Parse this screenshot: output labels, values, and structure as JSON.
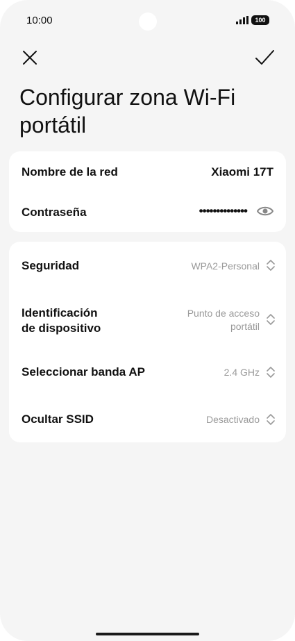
{
  "status": {
    "time": "10:00",
    "battery": "100"
  },
  "header": {
    "title": "Configurar zona Wi-Fi portátil"
  },
  "network": {
    "name_label": "Nombre de la red",
    "name_value": "Xiaomi 17T",
    "password_label": "Contraseña",
    "password_value": "••••••••••••••"
  },
  "settings": [
    {
      "label": "Seguridad",
      "value": "WPA2-Personal"
    },
    {
      "label_line1": "Identificación",
      "label_line2": "de dispositivo",
      "value_line1": "Punto de acceso",
      "value_line2": "portátil"
    },
    {
      "label": "Seleccionar banda AP",
      "value": "2.4 GHz"
    },
    {
      "label": "Ocultar SSID",
      "value": "Desactivado"
    }
  ],
  "colors": {
    "background": "#f5f5f5",
    "card": "#ffffff",
    "muted": "#9a9a9a",
    "text": "#111111"
  },
  "icons": [
    "close-icon",
    "check-icon",
    "eye-icon",
    "chevron-updown-icon",
    "signal-icon",
    "battery-icon"
  ]
}
